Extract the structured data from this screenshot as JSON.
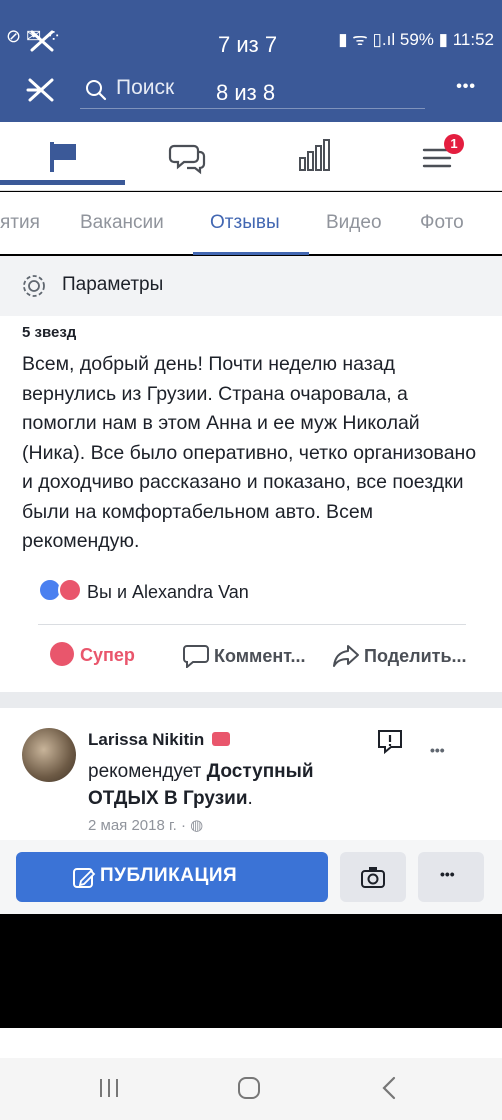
{
  "status_bar": {
    "battery": "59%",
    "time": "11:52"
  },
  "overlay": {
    "top_counter": "7 из 7",
    "header_counter": "8 из 8"
  },
  "header": {
    "search_label": "Поиск",
    "more": "•••"
  },
  "subtabs": [
    "ятия",
    "Вакансии",
    "Отзывы",
    "Видео",
    "Фото"
  ],
  "notification_badge": "1",
  "params_label": "Параметры",
  "review": {
    "stars_label": "5 звезд",
    "text": "Всем, добрый день! Почти неделю назад вернулись из Грузии. Страна очаровала, а помогли нам в этом Анна и ее муж Николай (Ника). Все было оперативно, четко организовано и доходчиво рассказано и показано, все поездки были на комфортабельном авто. Всем рекомендую.",
    "reactions_text": "Вы и Alexandra Van",
    "actions": {
      "react": "Супер",
      "comment": "Коммент...",
      "share": "Поделить..."
    }
  },
  "post2": {
    "author": "Larissa Nikitin",
    "verb": "рекомендует",
    "page_name": "Доступный ОТДЫХ В Грузии",
    "punct": ".",
    "date": "2 мая 2018 г. · ",
    "more": "•••"
  },
  "bottom": {
    "publish": "ПУБЛИКАЦИЯ",
    "more": "•••"
  },
  "colors": {
    "brand": "#3b5998",
    "button": "#3b73d6",
    "badge": "#e41e3f",
    "super": "#e9566c"
  }
}
